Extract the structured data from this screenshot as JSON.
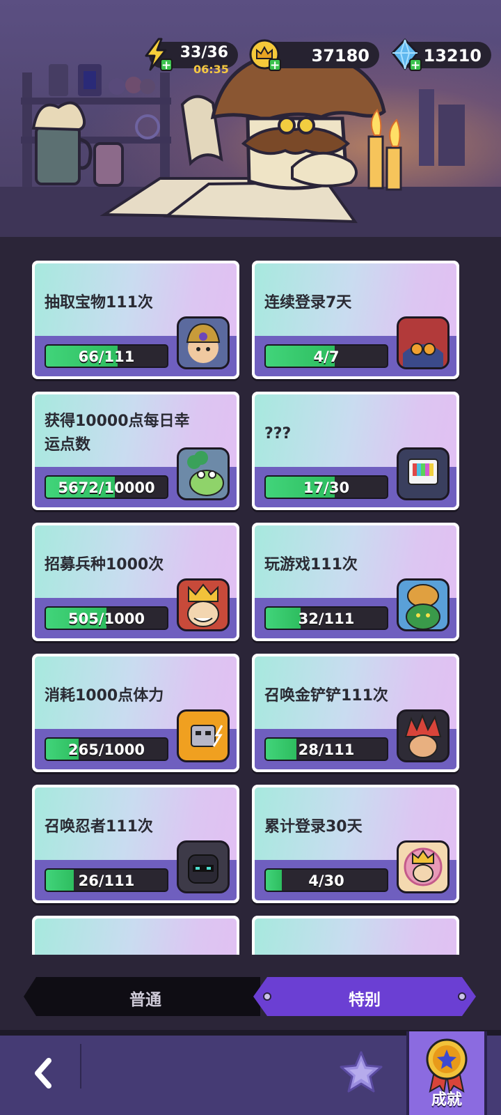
{
  "resources": {
    "energy": {
      "value": "33/36",
      "timer": "06:35",
      "icon": "lightning-icon"
    },
    "gold": {
      "value": "37180",
      "icon": "crown-coin-icon"
    },
    "gems": {
      "value": "13210",
      "icon": "diamond-icon"
    }
  },
  "achievements": [
    {
      "title": "抽取宝物111次",
      "progress": "66/111",
      "fraction": 0.59,
      "icon": "miner-portrait"
    },
    {
      "title": "连续登录7天",
      "progress": "4/7",
      "fraction": 0.57,
      "icon": "spider-robot-portrait"
    },
    {
      "title": "获得10000点每日幸运点数",
      "progress": "5672/10000",
      "fraction": 0.57,
      "icon": "frog-clover-portrait"
    },
    {
      "title": "???",
      "progress": "17/30",
      "fraction": 0.57,
      "icon": "tv-head-portrait"
    },
    {
      "title": "招募兵种1000次",
      "progress": "505/1000",
      "fraction": 0.5,
      "icon": "king-portrait"
    },
    {
      "title": "玩游戏111次",
      "progress": "32/111",
      "fraction": 0.29,
      "icon": "bear-goblin-portrait"
    },
    {
      "title": "消耗1000点体力",
      "progress": "265/1000",
      "fraction": 0.27,
      "icon": "robot-energy-portrait"
    },
    {
      "title": "召唤金铲铲111次",
      "progress": "28/111",
      "fraction": 0.25,
      "icon": "red-hair-portrait"
    },
    {
      "title": "召唤忍者111次",
      "progress": "26/111",
      "fraction": 0.23,
      "icon": "ninja-portrait"
    },
    {
      "title": "累计登录30天",
      "progress": "4/30",
      "fraction": 0.13,
      "icon": "crown-girl-portrait"
    }
  ],
  "tabs": {
    "normal": "普通",
    "special": "特别"
  },
  "nav": {
    "achievements": "成就"
  }
}
